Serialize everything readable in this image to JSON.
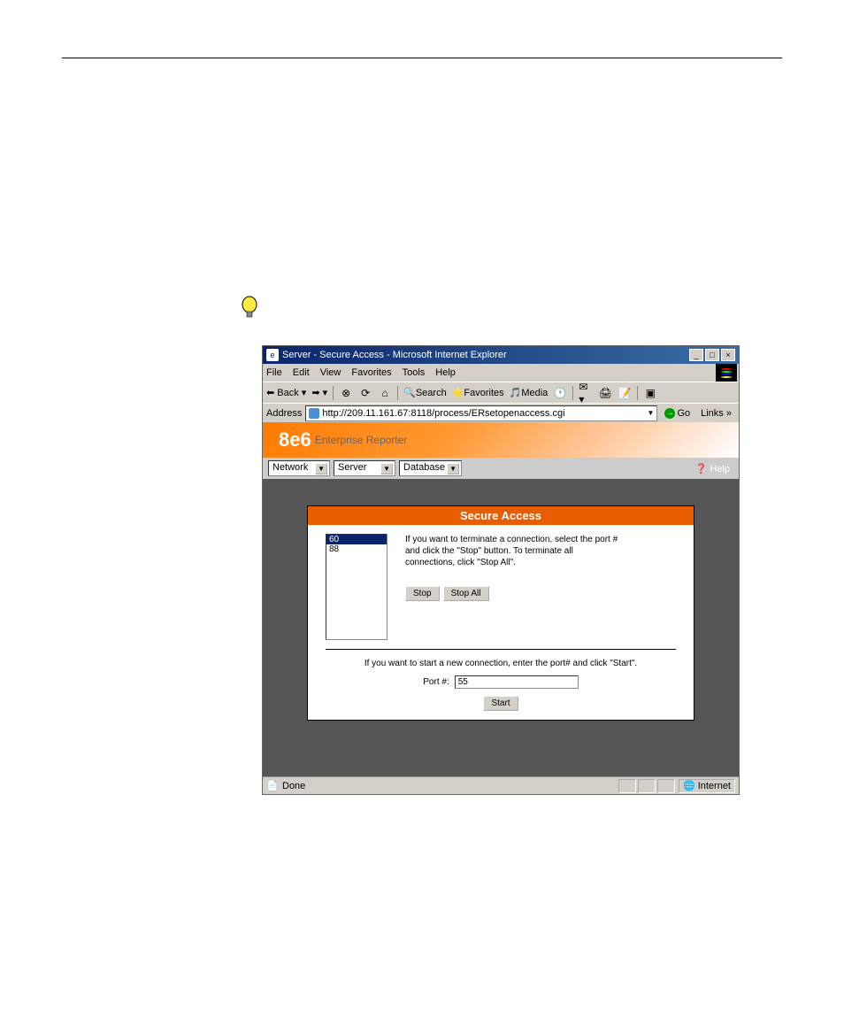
{
  "window": {
    "title": "Server - Secure Access - Microsoft Internet Explorer",
    "minimize": "_",
    "maximize": "□",
    "close": "×"
  },
  "menu": {
    "file": "File",
    "edit": "Edit",
    "view": "View",
    "favorites": "Favorites",
    "tools": "Tools",
    "help": "Help"
  },
  "toolbar": {
    "back": "Back",
    "search": "Search",
    "favorites": "Favorites",
    "media": "Media"
  },
  "address": {
    "label": "Address",
    "url": "http://209.11.161.67:8118/process/ERsetopenaccess.cgi",
    "go": "Go",
    "links": "Links"
  },
  "header": {
    "logo": "8e6",
    "subtitle": "Enterprise Reporter"
  },
  "nav": {
    "network": "Network",
    "server": "Server",
    "database": "Database",
    "help": "Help"
  },
  "panel": {
    "title": "Secure Access",
    "ports": [
      "60",
      "88"
    ],
    "instruction1": "If you want to terminate a connection, select the port #",
    "instruction2": "and click the \"Stop\" button. To terminate all",
    "instruction3": "connections, click \"Stop All\".",
    "stop": "Stop",
    "stop_all": "Stop All",
    "start_instruction": "If you want to start a new connection, enter the port# and click \"Start\".",
    "port_label": "Port #:",
    "port_value": "55",
    "start": "Start"
  },
  "status": {
    "done": "Done",
    "zone": "Internet"
  },
  "chart_data": null
}
